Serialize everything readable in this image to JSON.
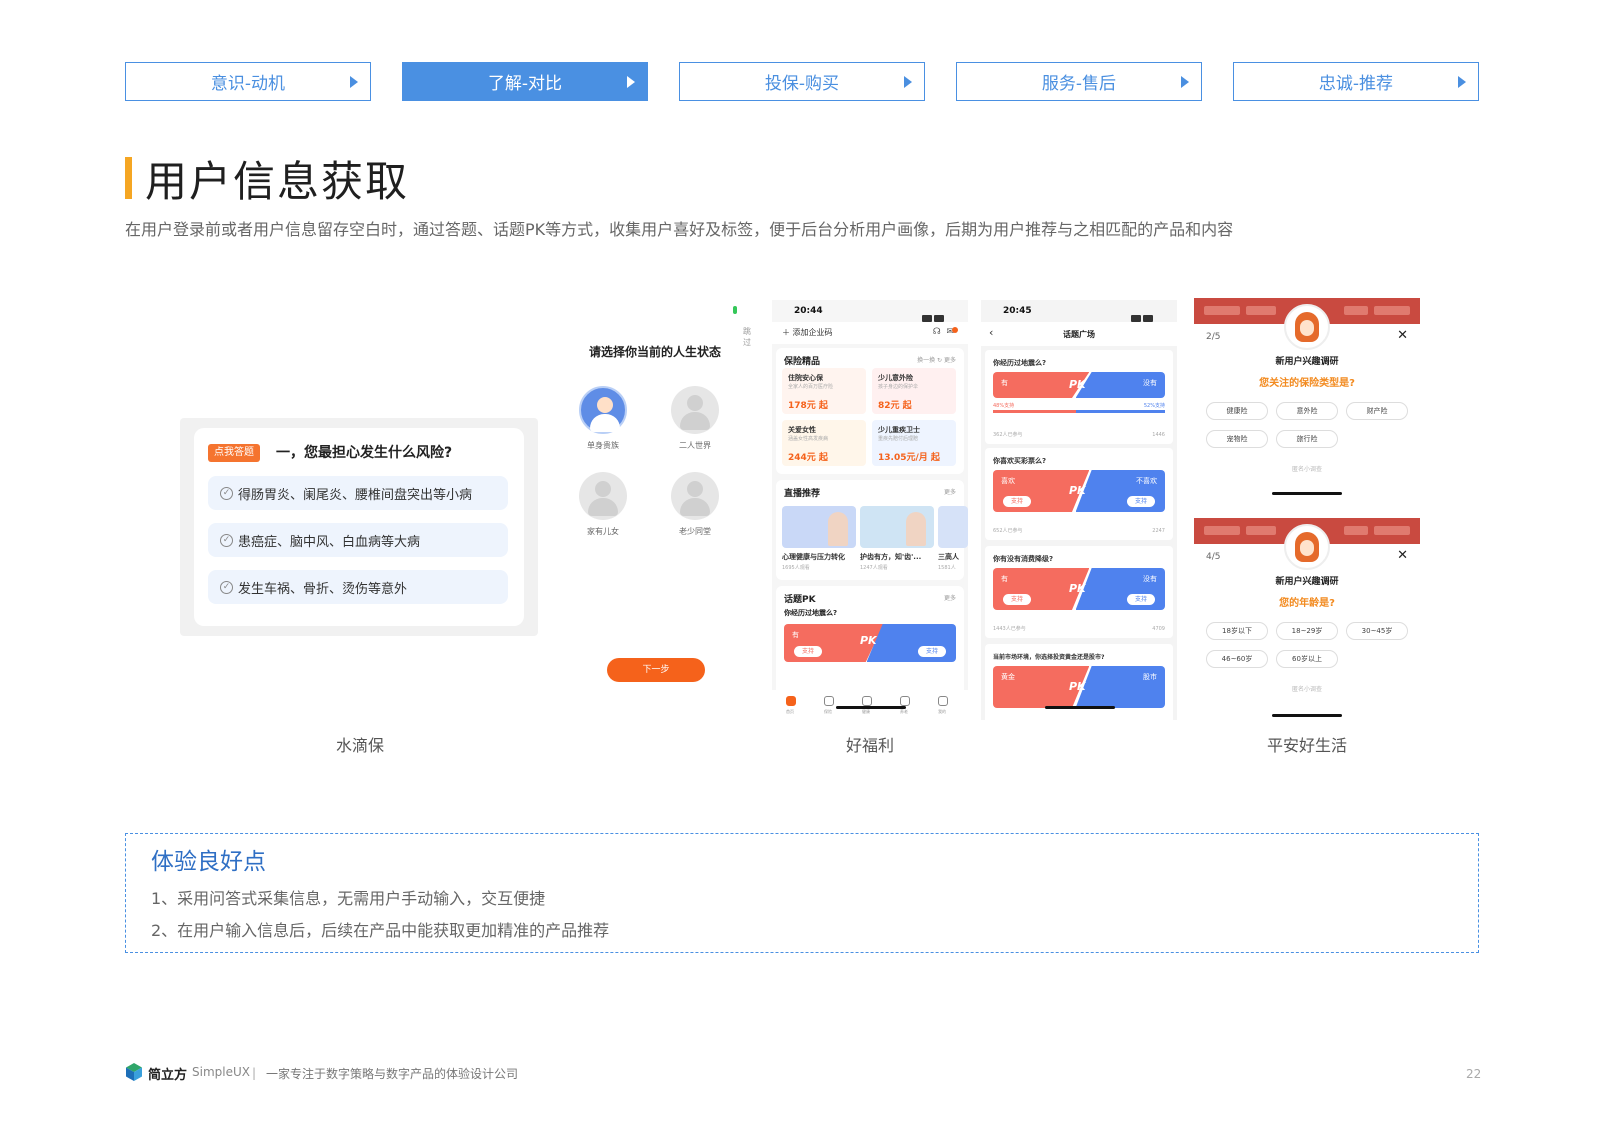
{
  "tabs": [
    {
      "label": "意识-动机",
      "active": false
    },
    {
      "label": "了解-对比",
      "active": true
    },
    {
      "label": "投保-购买",
      "active": false
    },
    {
      "label": "服务-售后",
      "active": false
    },
    {
      "label": "忠诚-推荐",
      "active": false
    }
  ],
  "title": "用户信息获取",
  "subtitle": "在用户登录前或者用户信息留存空白时，通过答题、话题PK等方式，收集用户喜好及标签，便于后台分析用户画像，后期为用户推荐与之相匹配的产品和内容",
  "shuidibao": {
    "tag": "点我答题",
    "question": "一，您最担心发生什么风险?",
    "options": [
      "得肠胃炎、阑尾炎、腰椎间盘突出等小病",
      "患癌症、脑中风、白血病等大病",
      "发生车祸、骨折、烫伤等意外"
    ]
  },
  "life_status": {
    "skip": "跳过",
    "title": "请选择你当前的人生状态",
    "options": [
      "单身贵族",
      "二人世界",
      "家有儿女",
      "老少同堂"
    ],
    "next": "下一步"
  },
  "haofuli_home": {
    "time": "20:44",
    "add_company": "添加企业码",
    "sec_products": "保险精品",
    "refresh": "换一换",
    "more": "更多",
    "products": [
      {
        "name": "住院安心保",
        "desc": "全家人的百万医疗险",
        "price": "178元 起"
      },
      {
        "name": "少儿意外险",
        "desc": "孩子身边的保护伞",
        "price": "82元 起"
      },
      {
        "name": "关爱女性",
        "desc": "涵盖女性高发疾病",
        "price": "244元 起"
      },
      {
        "name": "少儿重疾卫士",
        "desc": "重疾先赔付后理赔",
        "price": "13.05元/月 起"
      }
    ],
    "sec_live": "直播推荐",
    "lives": [
      {
        "title": "心理健康与压力转化",
        "sub": "1695人观看"
      },
      {
        "title": "护齿有方，知'齿'...",
        "sub": "1247人观看"
      },
      {
        "title": "三高人",
        "sub": "1581人"
      }
    ],
    "sec_pk": "话题PK",
    "pk_question": "你经历过地震么?",
    "pk_left": "有",
    "pk_mid": "PK",
    "pk_support": "支持",
    "tab_labels": [
      "首页",
      "保险",
      "健康",
      "养老",
      "我的"
    ]
  },
  "haofuli_topic": {
    "time": "20:45",
    "title": "话题广场",
    "topics": [
      {
        "q": "你经历过地震么?",
        "left": "有",
        "right": "没有",
        "left_ratio": "48%支持",
        "right_ratio": "52%支持",
        "joined": "362人已参与",
        "count": "1446"
      },
      {
        "q": "你喜欢买彩票么?",
        "left": "喜欢",
        "right": "不喜欢",
        "joined": "652人已参与",
        "count": "2247"
      },
      {
        "q": "你有没有消费降级?",
        "left": "有",
        "right": "没有",
        "joined": "1443人已参与",
        "count": "4709"
      },
      {
        "q": "当前市场环境，你选择投资黄金还是股市?",
        "left": "黄金",
        "right": "股市"
      }
    ],
    "pk": "PK",
    "support": "支持"
  },
  "pingan": [
    {
      "step": "2/5",
      "heading": "新用户兴趣调研",
      "question": "您关注的保险类型是?",
      "chips": [
        "健康险",
        "意外险",
        "财产险",
        "宠物险",
        "旅行险"
      ],
      "anon": "匿名小调查"
    },
    {
      "step": "4/5",
      "heading": "新用户兴趣调研",
      "question": "您的年龄是?",
      "chips": [
        "18岁以下",
        "18~29岁",
        "30~45岁",
        "46~60岁",
        "60岁以上"
      ],
      "anon": "匿名小调查"
    }
  ],
  "captions": [
    "水滴保",
    "好福利",
    "平安好生活"
  ],
  "highlight": {
    "title": "体验良好点",
    "items": [
      "1、采用问答式采集信息，无需用户手动输入，交互便捷",
      "2、在用户输入信息后，后续在产品中能获取更加精准的产品推荐"
    ]
  },
  "footer": {
    "brand": "简立方",
    "brand_en": "SimpleUX",
    "separator": "|",
    "tagline": "一家专注于数字策略与数字产品的体验设计公司",
    "page": "22"
  },
  "colors": {
    "accent": "#4a90e2",
    "orange": "#f5a623",
    "cta": "#f5621b",
    "pk_red": "#f56c5f",
    "pk_blue": "#4f82ee"
  }
}
